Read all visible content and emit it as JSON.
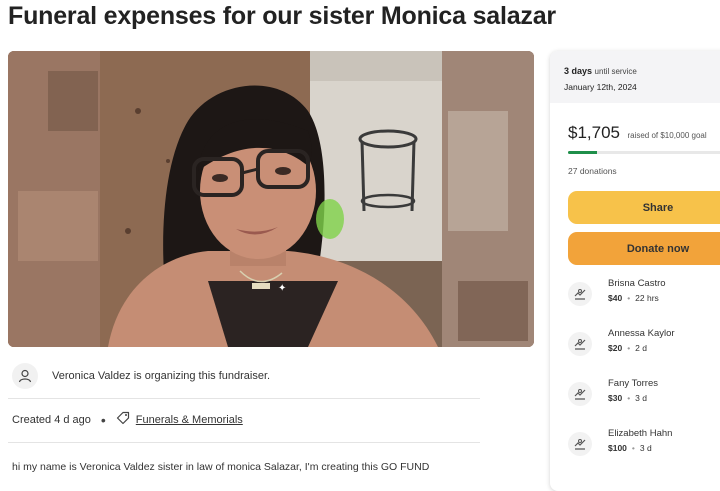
{
  "page": {
    "title": "Funeral expenses for our sister Monica salazar"
  },
  "organizer": {
    "text": "Veronica Valdez is organizing this fundraiser."
  },
  "meta": {
    "created": "Created 4 d ago",
    "separator": "•",
    "category": "Funerals & Memorials"
  },
  "story": {
    "text": "hi my name is Veronica Valdez sister in law of monica Salazar, I'm creating this GO FUND"
  },
  "sidebar": {
    "deadline_bold": "3 days",
    "deadline_rest": "until service",
    "deadline_date": "January 12th, 2024",
    "raised_amount": "$1,705",
    "raised_goal": "raised of $10,000 goal",
    "progress_fraction": 0.17,
    "donations_count": "27 donations",
    "share_label": "Share",
    "donate_label": "Donate now",
    "donors": [
      {
        "name": "Brisna Castro",
        "amount": "$40",
        "time": "22 hrs"
      },
      {
        "name": "Annessa Kaylor",
        "amount": "$20",
        "time": "2 d"
      },
      {
        "name": "Fany Torres",
        "amount": "$30",
        "time": "3 d"
      },
      {
        "name": "Elizabeth Hahn",
        "amount": "$100",
        "time": "3 d"
      }
    ],
    "donor_separator": "•"
  },
  "colors": {
    "share_button": "#f7c24a",
    "donate_button": "#f2a33a",
    "progress": "#1f8f4a"
  }
}
